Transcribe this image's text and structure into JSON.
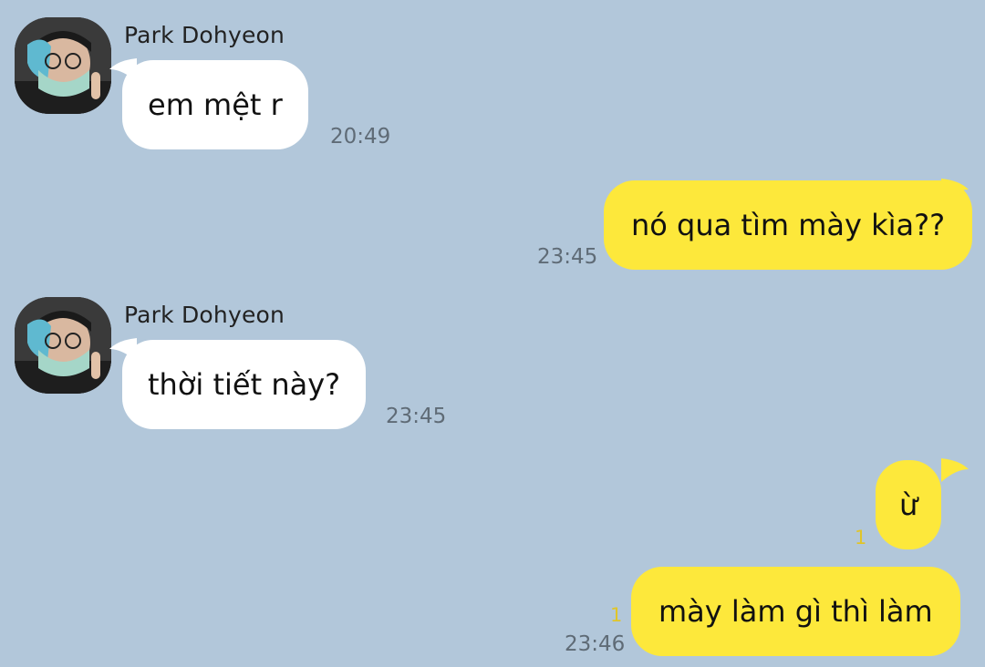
{
  "chat": {
    "messages": [
      {
        "side": "in",
        "sender": "Park Dohyeon",
        "text": "em mệt r",
        "time": "20:49"
      },
      {
        "side": "out",
        "text": "nó qua tìm mày kìa??",
        "time": "23:45"
      },
      {
        "side": "in",
        "sender": "Park Dohyeon",
        "text": "thời tiết này?",
        "time": "23:45"
      },
      {
        "side": "out",
        "text": "ừ",
        "unread": "1"
      },
      {
        "side": "out",
        "text": "mày làm gì thì làm",
        "unread": "1",
        "time": "23:46"
      }
    ]
  },
  "colors": {
    "background": "#b2c7da",
    "incoming_bubble": "#ffffff",
    "outgoing_bubble": "#fde83b",
    "unread_count": "#e0c52a"
  },
  "icons": {
    "avatar": "profile-photo-avatar"
  }
}
